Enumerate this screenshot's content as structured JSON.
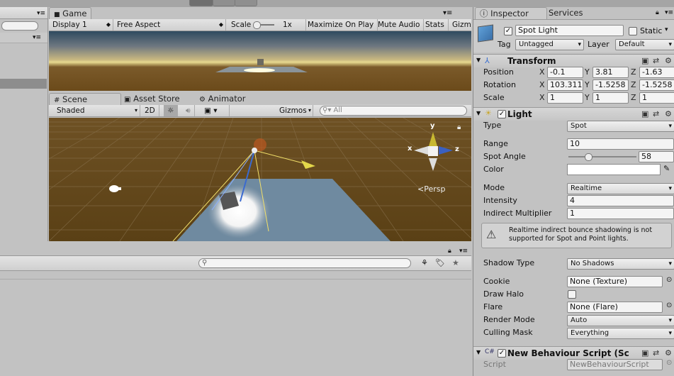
{
  "game": {
    "tab": "Game",
    "display": "Display 1",
    "aspect": "Free Aspect",
    "scale_label": "Scale",
    "scale_value": "1x",
    "maximize": "Maximize On Play",
    "mute": "Mute Audio",
    "stats": "Stats",
    "gizmos": "Gizm"
  },
  "scene": {
    "tabs": [
      "Scene",
      "Asset Store",
      "Animator"
    ],
    "shading": "Shaded",
    "mode_2d": "2D",
    "gizmos": "Gizmos",
    "search_placeholder": "All",
    "persp": "Persp",
    "axis_x": "x",
    "axis_y": "y",
    "axis_z": "z"
  },
  "inspector": {
    "tabs": [
      "Inspector",
      "Services"
    ],
    "object_name": "Spot Light",
    "static_label": "Static",
    "tag_label": "Tag",
    "tag_value": "Untagged",
    "layer_label": "Layer",
    "layer_value": "Default",
    "transform": {
      "title": "Transform",
      "position_label": "Position",
      "position": {
        "x": "-0.1",
        "y": "3.81",
        "z": "-1.63"
      },
      "rotation_label": "Rotation",
      "rotation": {
        "x": "103.311",
        "y": "-1.5258",
        "z": "-1.5258"
      },
      "scale_label": "Scale",
      "scale": {
        "x": "1",
        "y": "1",
        "z": "1"
      }
    },
    "light": {
      "title": "Light",
      "type_label": "Type",
      "type_value": "Spot",
      "range_label": "Range",
      "range_value": "10",
      "spot_angle_label": "Spot Angle",
      "spot_angle_value": "58",
      "color_label": "Color",
      "color_value": "#ffffff",
      "mode_label": "Mode",
      "mode_value": "Realtime",
      "intensity_label": "Intensity",
      "intensity_value": "4",
      "indirect_label": "Indirect Multiplier",
      "indirect_value": "1",
      "warning": "Realtime indirect bounce shadowing is not supported for Spot and Point lights.",
      "shadow_type_label": "Shadow Type",
      "shadow_type_value": "No Shadows",
      "cookie_label": "Cookie",
      "cookie_value": "None (Texture)",
      "draw_halo_label": "Draw Halo",
      "flare_label": "Flare",
      "flare_value": "None (Flare)",
      "render_mode_label": "Render Mode",
      "render_mode_value": "Auto",
      "culling_mask_label": "Culling Mask",
      "culling_mask_value": "Everything"
    },
    "script_component": {
      "title": "New Behaviour Script (Sc",
      "script_label": "Script",
      "script_value": "NewBehaviourScript"
    }
  }
}
